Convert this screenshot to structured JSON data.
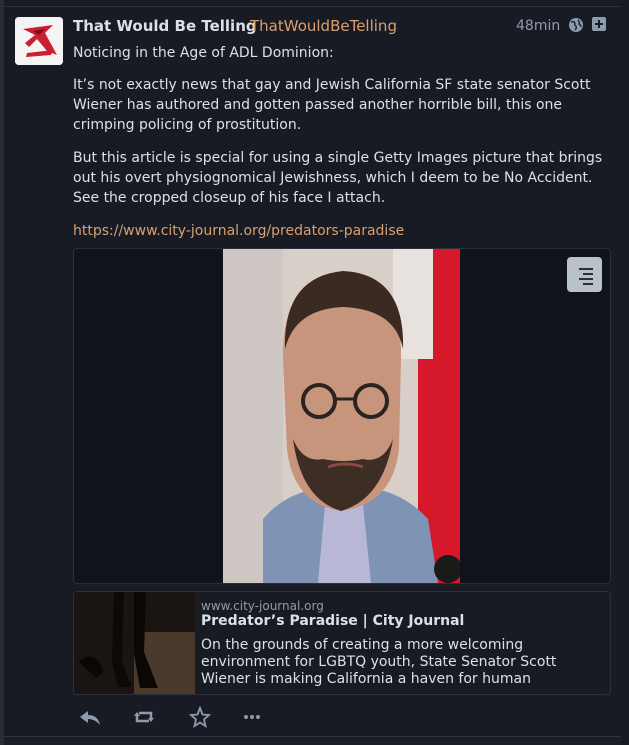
{
  "post": {
    "display_name": "That Would Be Telling",
    "handle": "ThatWouldBeTelling",
    "time_ago": "48min",
    "visibility_icon": "globe-icon",
    "expand_icon": "plus-square-icon",
    "avatar_icon": "logo-avatar",
    "paragraphs": [
      "Noticing in the Age of ADL Dominion:",
      "It’s not exactly news that gay and Jewish California SF state senator Scott Wiener has authored and gotten passed another horrible bill, this one crimping policing of prostitution.",
      "But this article is special for using a single Getty Images picture that brings out his overt physiognomical Jewishness, which I deem to be No Accident. See the cropped closeup of his face I attach."
    ],
    "link": "https://www.city-journal.org/predators-paradise"
  },
  "media": {
    "toggle_icon": "hide-media-icon"
  },
  "card": {
    "host": "www.city-journal.org",
    "title": "Predator’s Paradise | City Journal",
    "description": "On the grounds of creating a more welcoming environment for LGBTQ youth, State Senator Scott Wiener is making California a haven for human"
  },
  "actions": [
    "reply-icon",
    "boost-icon",
    "favourite-icon",
    "more-icon"
  ],
  "colors": {
    "background": "#191b22",
    "text": "#d9e1e8",
    "muted": "#8e9bab",
    "link": "#d8a070"
  }
}
